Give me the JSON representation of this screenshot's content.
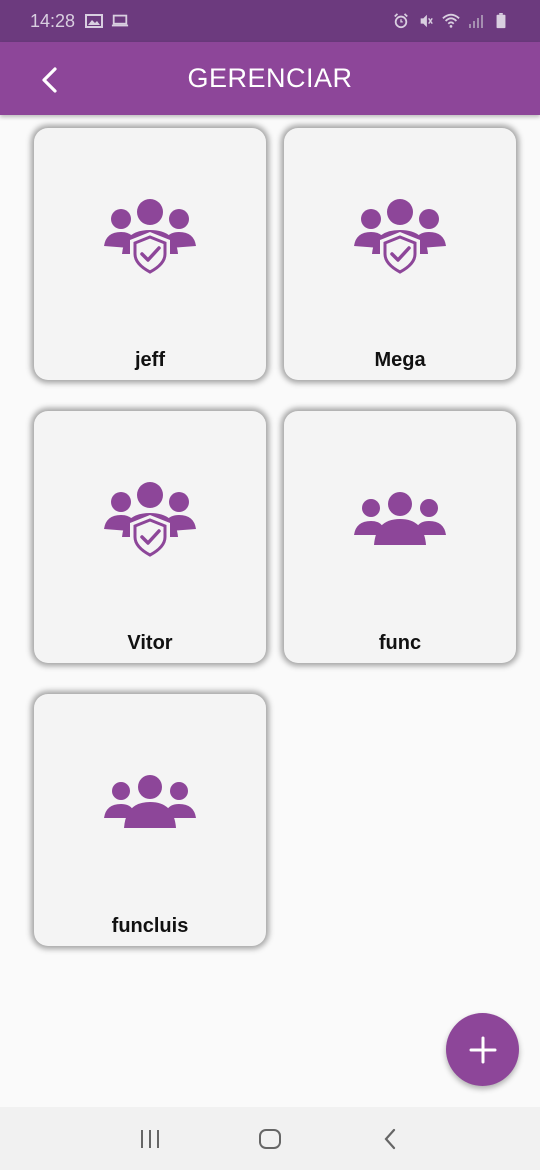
{
  "status_bar": {
    "time": "14:28",
    "icons": [
      "image-icon",
      "laptop-icon",
      "alarm-icon",
      "mute-icon",
      "wifi-icon",
      "signal-icon",
      "battery-icon"
    ]
  },
  "app_bar": {
    "title": "GERENCIAR",
    "back_icon": "back-arrow-icon"
  },
  "groups": [
    {
      "label": "jeff",
      "icon": "admin-group-icon"
    },
    {
      "label": "Mega",
      "icon": "admin-group-icon"
    },
    {
      "label": "Vitor",
      "icon": "admin-group-icon"
    },
    {
      "label": "func",
      "icon": "group-icon"
    },
    {
      "label": "funcluis",
      "icon": "group-icon"
    }
  ],
  "fab": {
    "icon": "plus-icon"
  },
  "nav_bar": {
    "icons": [
      "recent-apps-icon",
      "home-icon",
      "back-icon"
    ]
  },
  "colors": {
    "primary": "#8d4699",
    "primary_dark": "#6c3a7e",
    "card": "#f4f4f4",
    "background": "#fafafa"
  }
}
